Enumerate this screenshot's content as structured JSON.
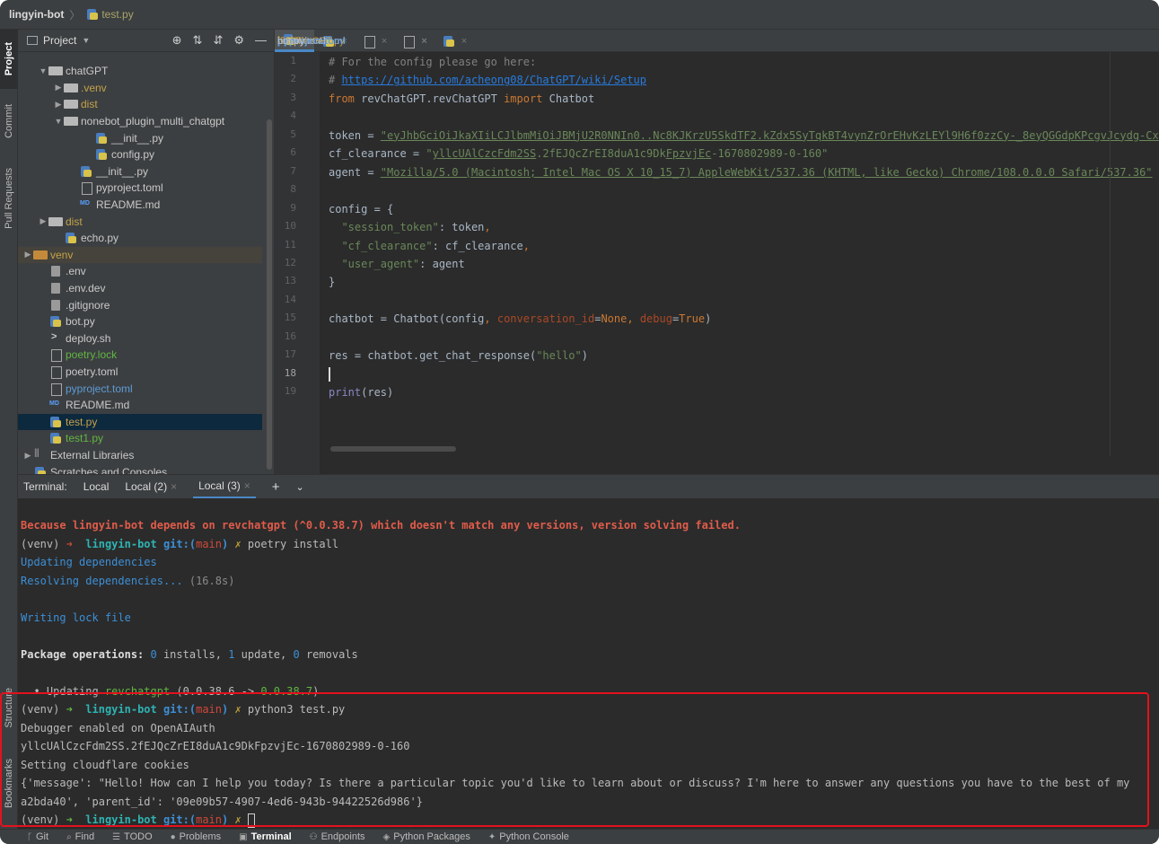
{
  "breadcrumb": {
    "project": "lingyin-bot",
    "file": "test.py"
  },
  "left_strip": [
    "Project",
    "Commit",
    "Pull Requests",
    "Structure",
    "Bookmarks"
  ],
  "project_panel": {
    "title": "Project",
    "tree": [
      {
        "label": "chatGPT",
        "kind": "folder",
        "indent": 2,
        "arrow": "v",
        "style": ""
      },
      {
        "label": ".venv",
        "kind": "folder",
        "indent": 3,
        "arrow": ">",
        "style": "orange"
      },
      {
        "label": "dist",
        "kind": "folder",
        "indent": 3,
        "arrow": ">",
        "style": "orange"
      },
      {
        "label": "nonebot_plugin_multi_chatgpt",
        "kind": "folder",
        "indent": 3,
        "arrow": "v",
        "style": ""
      },
      {
        "label": "__init__.py",
        "kind": "py",
        "indent": 5,
        "arrow": "",
        "style": ""
      },
      {
        "label": "config.py",
        "kind": "py",
        "indent": 5,
        "arrow": "",
        "style": ""
      },
      {
        "label": "__init__.py",
        "kind": "py",
        "indent": 4,
        "arrow": "",
        "style": ""
      },
      {
        "label": "pyproject.toml",
        "kind": "toml",
        "indent": 4,
        "arrow": "",
        "style": ""
      },
      {
        "label": "README.md",
        "kind": "md",
        "indent": 4,
        "arrow": "",
        "style": ""
      },
      {
        "label": "dist",
        "kind": "folder",
        "indent": 2,
        "arrow": ">",
        "style": "orange"
      },
      {
        "label": "echo.py",
        "kind": "py",
        "indent": 3,
        "arrow": "",
        "style": ""
      },
      {
        "label": "venv",
        "kind": "folder-orange",
        "indent": 1,
        "arrow": ">",
        "style": "orange hl"
      },
      {
        "label": ".env",
        "kind": "file",
        "indent": 2,
        "arrow": "",
        "style": ""
      },
      {
        "label": ".env.dev",
        "kind": "file",
        "indent": 2,
        "arrow": "",
        "style": ""
      },
      {
        "label": ".gitignore",
        "kind": "file",
        "indent": 2,
        "arrow": "",
        "style": ""
      },
      {
        "label": "bot.py",
        "kind": "py",
        "indent": 2,
        "arrow": "",
        "style": ""
      },
      {
        "label": "deploy.sh",
        "kind": "sh",
        "indent": 2,
        "arrow": "",
        "style": ""
      },
      {
        "label": "poetry.lock",
        "kind": "toml",
        "indent": 2,
        "arrow": "",
        "style": "green"
      },
      {
        "label": "poetry.toml",
        "kind": "toml",
        "indent": 2,
        "arrow": "",
        "style": ""
      },
      {
        "label": "pyproject.toml",
        "kind": "toml",
        "indent": 2,
        "arrow": "",
        "style": "blue"
      },
      {
        "label": "README.md",
        "kind": "md",
        "indent": 2,
        "arrow": "",
        "style": ""
      },
      {
        "label": "test.py",
        "kind": "py",
        "indent": 2,
        "arrow": "",
        "style": "orange selected"
      },
      {
        "label": "test1.py",
        "kind": "py",
        "indent": 2,
        "arrow": "",
        "style": "green"
      },
      {
        "label": "External Libraries",
        "kind": "lib",
        "indent": 1,
        "arrow": ">",
        "style": ""
      },
      {
        "label": "Scratches and Consoles",
        "kind": "scratch",
        "indent": 1,
        "arrow": "",
        "style": ""
      }
    ]
  },
  "editor_tabs": [
    {
      "label": "test.py",
      "style": "t-orange",
      "active": true
    },
    {
      "label": "revChatGPT.py",
      "style": "t-orange",
      "active": false
    },
    {
      "label": "poetry.toml",
      "style": "",
      "active": false
    },
    {
      "label": "pyproject.toml",
      "style": "t-blue",
      "active": false
    },
    {
      "label": "bot.py",
      "style": "",
      "active": false
    }
  ],
  "code_lines": [
    [
      [
        "cm",
        "# For the config please go here:"
      ]
    ],
    [
      [
        "cm",
        "# "
      ],
      [
        "link",
        "https://github.com/acheong08/ChatGPT/wiki/Setup"
      ]
    ],
    [
      [
        "kw",
        "from "
      ],
      [
        "",
        "revChatGPT.revChatGPT "
      ],
      [
        "kw",
        "import "
      ],
      [
        "",
        "Chatbot"
      ]
    ],
    [],
    [
      [
        "",
        "token = "
      ],
      [
        "str ul",
        "\"eyJhbGciOiJkaXIiLCJlbmMiOiJBMjU2R0NNIn0..Nc8KJKrzU5SkdTF2.kZdx5SyTqkBT4vynZrOrEHvKzLEYl9H6f0zzCy-_8eyQGGdpKPcgvJcydg-Cx"
      ]
    ],
    [
      [
        "",
        "cf_clearance = "
      ],
      [
        "str",
        "\""
      ],
      [
        "str ul",
        "yllcUAlCzcFdm2SS"
      ],
      [
        "str",
        ".2fEJQcZrEI8duA1c9Dk"
      ],
      [
        "str ul",
        "FpzvjEc"
      ],
      [
        "str",
        "-1670802989-0-160\""
      ]
    ],
    [
      [
        "",
        "agent = "
      ],
      [
        "str ul",
        "\"Mozilla/5.0 (Macintosh; Intel Mac OS X 10_15_7) AppleWebKit/537.36 (KHTML, like Gecko) Chrome/108.0.0.0 Safari/537.36\""
      ]
    ],
    [],
    [
      [
        "",
        "config = {"
      ]
    ],
    [
      [
        "",
        "  "
      ],
      [
        "str",
        "\"session_token\""
      ],
      [
        "",
        ": token"
      ],
      [
        "kw",
        ","
      ]
    ],
    [
      [
        "",
        "  "
      ],
      [
        "str",
        "\"cf_clearance\""
      ],
      [
        "",
        ": cf_clearance"
      ],
      [
        "kw",
        ","
      ]
    ],
    [
      [
        "",
        "  "
      ],
      [
        "str",
        "\"user_agent\""
      ],
      [
        "",
        ": agent"
      ]
    ],
    [
      [
        "",
        "}"
      ]
    ],
    [],
    [
      [
        "",
        "chatbot = Chatbot(config"
      ],
      [
        "kw",
        ", "
      ],
      [
        "param",
        "conversation_id"
      ],
      [
        "",
        "="
      ],
      [
        "kw",
        "None"
      ],
      [
        "kw",
        ", "
      ],
      [
        "param",
        "debug"
      ],
      [
        "",
        "="
      ],
      [
        "kw",
        "True"
      ],
      [
        "",
        ")"
      ]
    ],
    [],
    [
      [
        "",
        "res = chatbot.get_chat_response("
      ],
      [
        "str",
        "\"hello\""
      ],
      [
        "",
        ")"
      ]
    ],
    [],
    [
      [
        "bi",
        "print"
      ],
      [
        "",
        "(res)"
      ]
    ]
  ],
  "current_line": 18,
  "terminal": {
    "label": "Terminal:",
    "tabs": [
      {
        "label": "Local",
        "active": false
      },
      {
        "label": "Local (2)",
        "active": false
      },
      {
        "label": "Local (3)",
        "active": true
      }
    ],
    "lines": [
      [
        [
          "t-err",
          "Because lingyin-bot depends on revchatgpt (^0.0.38.7) which doesn't match any versions, version solving failed."
        ]
      ],
      [
        [
          "",
          "(venv) "
        ],
        [
          "t-arrow",
          "➜  "
        ],
        [
          "t-cyan",
          "lingyin-bot "
        ],
        [
          "t-blue",
          "git:("
        ],
        [
          "t-red",
          "main"
        ],
        [
          "t-blue",
          ") "
        ],
        [
          "t-yellow",
          "✗ "
        ],
        [
          "",
          "poetry install"
        ]
      ],
      [
        [
          "t-blue2",
          "Updating dependencies"
        ]
      ],
      [
        [
          "t-blue2",
          "Resolving dependencies... "
        ],
        [
          "t-dim",
          "(16.8s)"
        ]
      ],
      [],
      [
        [
          "t-blue2",
          "Writing lock file"
        ]
      ],
      [],
      [
        [
          "t-bold",
          "Package operations: "
        ],
        [
          "t-blue2",
          "0"
        ],
        [
          "",
          " installs, "
        ],
        [
          "t-blue2",
          "1"
        ],
        [
          "",
          " update, "
        ],
        [
          "t-blue2",
          "0"
        ],
        [
          "",
          " removals"
        ]
      ],
      [],
      [
        [
          "",
          "  • Updating "
        ],
        [
          "t-green",
          "revchatgpt"
        ],
        [
          "",
          " (0.0.38.6 -> "
        ],
        [
          "t-green",
          "0.0.38.7"
        ],
        [
          "",
          ")"
        ]
      ],
      [
        [
          "",
          "(venv) "
        ],
        [
          "t-garrow",
          "➜  "
        ],
        [
          "t-cyan",
          "lingyin-bot "
        ],
        [
          "t-blue",
          "git:("
        ],
        [
          "t-red",
          "main"
        ],
        [
          "t-blue",
          ") "
        ],
        [
          "t-yellow",
          "✗ "
        ],
        [
          "",
          "python3 test.py"
        ]
      ],
      [
        [
          "",
          "Debugger enabled on OpenAIAuth"
        ]
      ],
      [
        [
          "",
          "yllcUAlCzcFdm2SS.2fEJQcZrEI8duA1c9DkFpzvjEc-1670802989-0-160"
        ]
      ],
      [
        [
          "",
          "Setting cloudflare cookies"
        ]
      ],
      [
        [
          "",
          "{'message': \"Hello! How can I help you today? Is there a particular topic you'd like to learn about or discuss? I'm here to answer any questions you have to the best of my"
        ]
      ],
      [
        [
          "",
          "a2bda40', 'parent_id': '09e09b57-4907-4ed6-943b-94422526d986'}"
        ]
      ],
      [
        [
          "",
          "(venv) "
        ],
        [
          "t-garrow",
          "➜  "
        ],
        [
          "t-cyan",
          "lingyin-bot "
        ],
        [
          "t-blue",
          "git:("
        ],
        [
          "t-red",
          "main"
        ],
        [
          "t-blue",
          ") "
        ],
        [
          "t-yellow",
          "✗ "
        ],
        [
          "cursor",
          ""
        ]
      ]
    ]
  },
  "bottom_bar": [
    {
      "label": "Git",
      "icon": "git-icon",
      "active": false
    },
    {
      "label": "Find",
      "icon": "search-icon",
      "active": false
    },
    {
      "label": "TODO",
      "icon": "list-icon",
      "active": false
    },
    {
      "label": "Problems",
      "icon": "problems-icon",
      "active": false
    },
    {
      "label": "Terminal",
      "icon": "terminal-icon",
      "active": true
    },
    {
      "label": "Endpoints",
      "icon": "endpoints-icon",
      "active": false
    },
    {
      "label": "Python Packages",
      "icon": "packages-icon",
      "active": false
    },
    {
      "label": "Python Console",
      "icon": "console-icon",
      "active": false
    }
  ],
  "colors": {
    "selection": "#0d293e",
    "accent": "#4a88c7",
    "highlight_box": "#e3121e"
  }
}
